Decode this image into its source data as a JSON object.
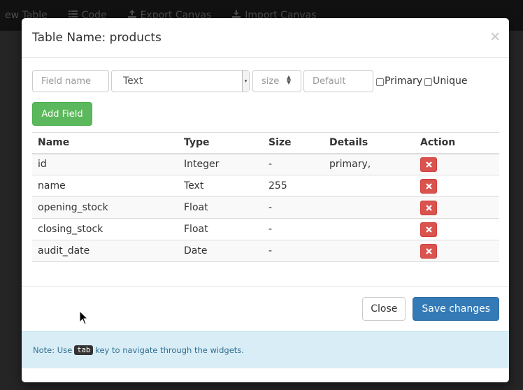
{
  "navbar": {
    "items": [
      {
        "label": "ew Table",
        "icon": ""
      },
      {
        "label": "Code",
        "icon": "list-icon"
      },
      {
        "label": "Export Canvas",
        "icon": "export-icon"
      },
      {
        "label": "Import Canvas",
        "icon": "import-icon"
      }
    ]
  },
  "modal": {
    "title": "Table Name: products",
    "close_glyph": "×",
    "form": {
      "field_name_placeholder": "Field name",
      "type_selected": "Text",
      "size_placeholder": "size",
      "default_placeholder": "Default",
      "primary_label": "Primary",
      "unique_label": "Unique",
      "add_button": "Add Field"
    },
    "table": {
      "headers": [
        "Name",
        "Type",
        "Size",
        "Details",
        "Action"
      ],
      "rows": [
        {
          "name": "id",
          "type": "Integer",
          "size": "-",
          "details": "primary,"
        },
        {
          "name": "name",
          "type": "Text",
          "size": "255",
          "details": ""
        },
        {
          "name": "opening_stock",
          "type": "Float",
          "size": "-",
          "details": ""
        },
        {
          "name": "closing_stock",
          "type": "Float",
          "size": "-",
          "details": ""
        },
        {
          "name": "audit_date",
          "type": "Date",
          "size": "-",
          "details": ""
        }
      ]
    },
    "footer": {
      "close_button": "Close",
      "save_button": "Save changes"
    },
    "note": {
      "prefix": "Note: Use",
      "key": "tab",
      "suffix": "key to navigate through the widgets."
    }
  },
  "colors": {
    "add_button": "#5cb85c",
    "save_button": "#337ab7",
    "delete_button": "#d9534f",
    "note_bg": "#d9edf7"
  }
}
